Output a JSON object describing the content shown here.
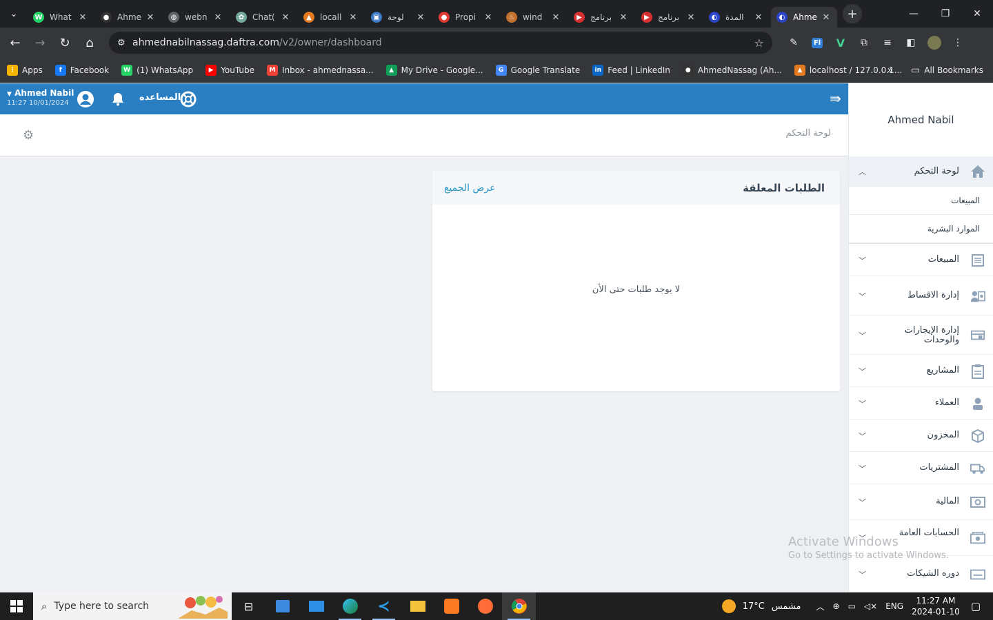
{
  "browser": {
    "tabs": [
      {
        "title": "What",
        "color": "#25d366",
        "glyph": "W"
      },
      {
        "title": "Ahme",
        "color": "#333333",
        "glyph": "●"
      },
      {
        "title": "webn",
        "color": "#5f6368",
        "glyph": "◍"
      },
      {
        "title": "Chat(",
        "color": "#74aa9c",
        "glyph": "✿"
      },
      {
        "title": "locall",
        "color": "#e37a1f",
        "glyph": "▲"
      },
      {
        "title": "لوحة",
        "color": "#3c7ac8",
        "glyph": "▣"
      },
      {
        "title": "Propi",
        "color": "#e03c31",
        "glyph": "●"
      },
      {
        "title": "wind",
        "color": "#c2702d",
        "glyph": "♨"
      },
      {
        "title": "برنامج",
        "color": "#d62f2f",
        "glyph": "▶"
      },
      {
        "title": "برنامج",
        "color": "#d62f2f",
        "glyph": "▶"
      },
      {
        "title": "المدة",
        "color": "#2b45c8",
        "glyph": "◐"
      },
      {
        "title": "Ahme",
        "color": "#2b45c8",
        "glyph": "◐",
        "active": true
      }
    ],
    "url_host": "ahmednabilnassag.daftra.com",
    "url_path": "/v2/owner/dashboard",
    "bookmarks": [
      {
        "label": "Apps",
        "color": "#f4b400",
        "glyph": "⋮"
      },
      {
        "label": "Facebook",
        "color": "#1877f2",
        "glyph": "f"
      },
      {
        "label": "(1) WhatsApp",
        "color": "#25d366",
        "glyph": "W"
      },
      {
        "label": "YouTube",
        "color": "#ff0000",
        "glyph": "▶"
      },
      {
        "label": "Inbox - ahmednassa...",
        "color": "#ea4335",
        "glyph": "M"
      },
      {
        "label": "My Drive - Google...",
        "color": "#0f9d58",
        "glyph": "▲"
      },
      {
        "label": "Google Translate",
        "color": "#4285f4",
        "glyph": "G"
      },
      {
        "label": "Feed | LinkedIn",
        "color": "#0a66c2",
        "glyph": "in"
      },
      {
        "label": "AhmedNassag (Ah...",
        "color": "#333333",
        "glyph": "●"
      },
      {
        "label": "localhost / 127.0.0.1...",
        "color": "#e37a1f",
        "glyph": "▲"
      }
    ],
    "more_bookmarks": "»",
    "all_bookmarks": "All Bookmarks"
  },
  "topbar": {
    "user_name": "Ahmed Nabil",
    "datetime": "11:27 10/01/2024",
    "help_label": "المساعده"
  },
  "subheader": {
    "breadcrumb": "لوحة التحكم"
  },
  "card": {
    "title": "الطلبات المعلقة",
    "view_all": "عرض الجميع",
    "empty_text": "لا يوجد طلبات حتى الأن"
  },
  "sidebar": {
    "user": "Ahmed Nabil",
    "dashboard": "لوحة التحكم",
    "dashboard_subs": [
      "المبيعات",
      "الموارد البشرية"
    ],
    "items": [
      {
        "label": "المبيعات",
        "icon": "invoice-icon"
      },
      {
        "label": "إدارة الاقساط",
        "icon": "installments-icon"
      },
      {
        "label": "إدارة الإيجارات والوحدات",
        "icon": "rentals-icon"
      },
      {
        "label": "المشاريع",
        "icon": "clipboard-icon"
      },
      {
        "label": "العملاء",
        "icon": "user-icon"
      },
      {
        "label": "المخزون",
        "icon": "box-icon"
      },
      {
        "label": "المشتريات",
        "icon": "truck-icon"
      },
      {
        "label": "المالية",
        "icon": "money-icon"
      },
      {
        "label": "الحسابات العامة",
        "icon": "accounts-icon"
      },
      {
        "label": "دوره الشيكات",
        "icon": "cheque-icon"
      }
    ]
  },
  "watermark": {
    "title": "Activate Windows",
    "subtitle": "Go to Settings to activate Windows."
  },
  "taskbar": {
    "search_placeholder": "Type here to search",
    "weather_temp": "17°C",
    "weather_label": "مشمس",
    "language": "ENG",
    "time": "11:27 AM",
    "date": "2024-01-10"
  },
  "colors": {
    "topbar": "#2a7fc3",
    "link": "#2a96c8",
    "sidebar_icon": "#8fa3b8"
  }
}
